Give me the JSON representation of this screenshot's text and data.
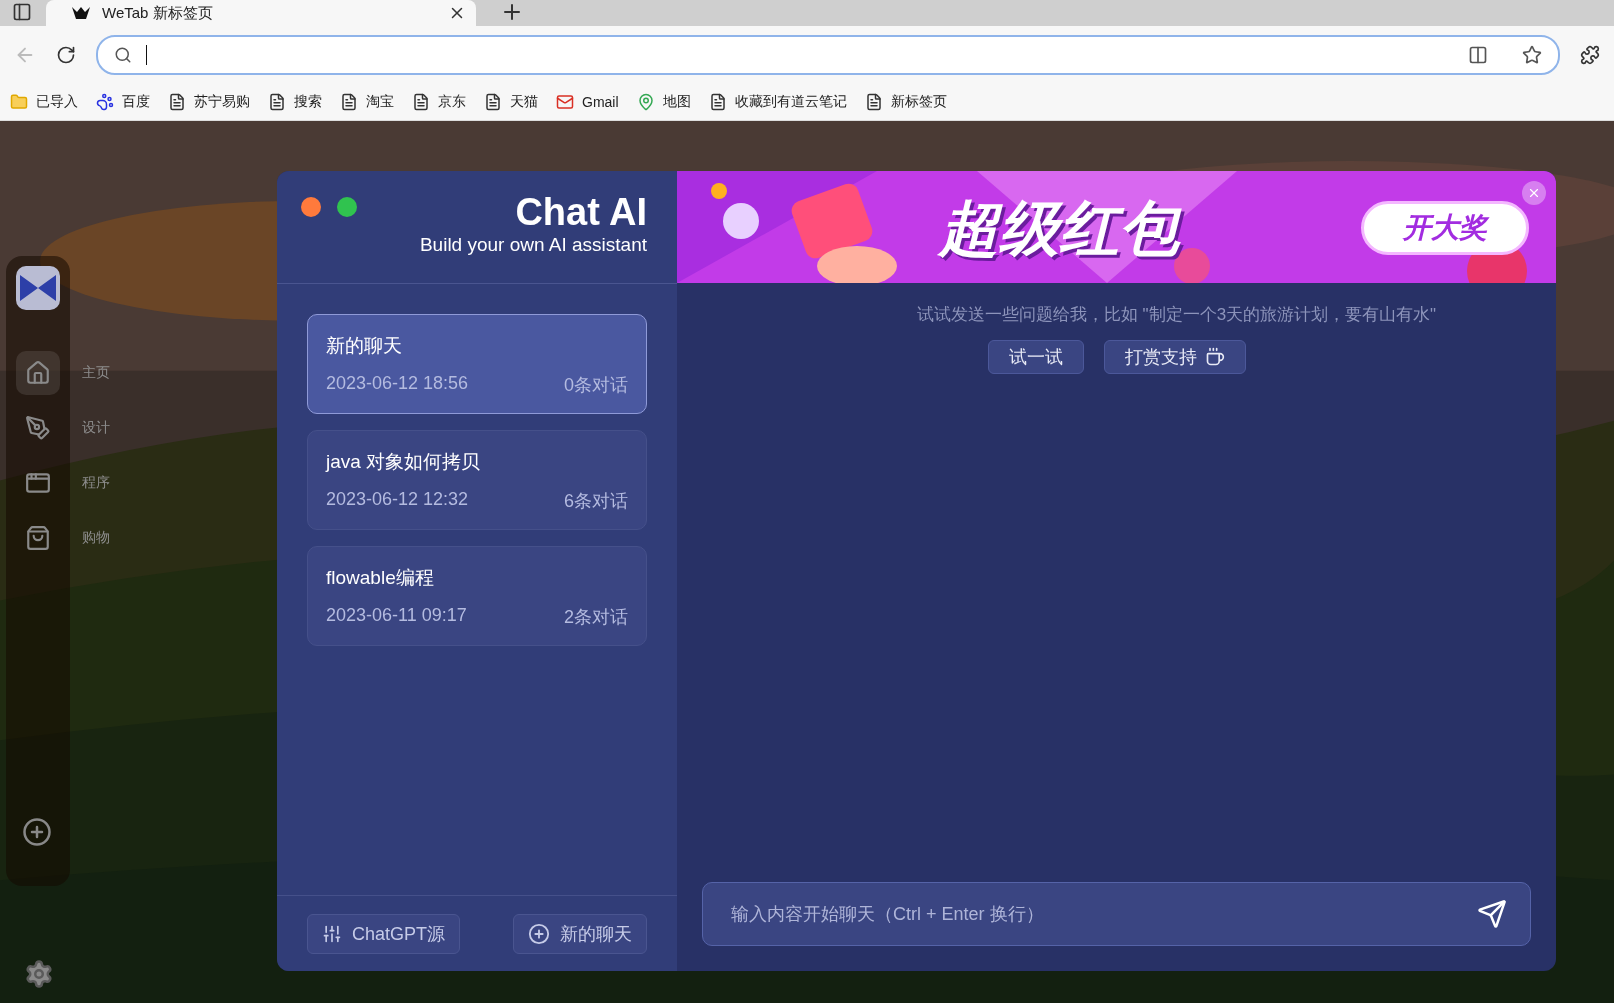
{
  "browser": {
    "tab": {
      "title": "WeTab 新标签页"
    },
    "bookmarks": [
      {
        "label": "已导入",
        "kind": "folder"
      },
      {
        "label": "百度",
        "kind": "baidu"
      },
      {
        "label": "苏宁易购",
        "kind": "page"
      },
      {
        "label": "搜索",
        "kind": "page"
      },
      {
        "label": "淘宝",
        "kind": "page"
      },
      {
        "label": "京东",
        "kind": "page"
      },
      {
        "label": "天猫",
        "kind": "page"
      },
      {
        "label": "Gmail",
        "kind": "gmail"
      },
      {
        "label": "地图",
        "kind": "maps"
      },
      {
        "label": "收藏到有道云笔记",
        "kind": "page"
      },
      {
        "label": "新标签页",
        "kind": "page"
      }
    ]
  },
  "dock": {
    "items": [
      {
        "label": "主页",
        "kind": "home",
        "selected": true
      },
      {
        "label": "设计",
        "kind": "design",
        "selected": false
      },
      {
        "label": "程序",
        "kind": "code",
        "selected": false
      },
      {
        "label": "购物",
        "kind": "shop",
        "selected": false
      }
    ]
  },
  "chat": {
    "title": "Chat AI",
    "subtitle": "Build your own AI assistant",
    "banner": {
      "headline": "超级红包",
      "cta": "开大奖"
    },
    "sessions": [
      {
        "title": "新的聊天",
        "time": "2023-06-12 18:56",
        "count": "0条对话",
        "selected": true
      },
      {
        "title": "java 对象如何拷贝",
        "time": "2023-06-12 12:32",
        "count": "6条对话",
        "selected": false
      },
      {
        "title": "flowable编程",
        "time": "2023-06-11 09:17",
        "count": "2条对话",
        "selected": false
      }
    ],
    "footer_buttons": [
      {
        "label": "ChatGPT源",
        "kind": "sliders"
      },
      {
        "label": "新的聊天",
        "kind": "add"
      }
    ],
    "hint": "试试发送一些问题给我，比如 \"制定一个3天的旅游计划，要有山有水\"",
    "actions": [
      {
        "label": "试一试",
        "kind": "plain"
      },
      {
        "label": "打赏支持",
        "kind": "coffee"
      }
    ],
    "input": {
      "placeholder": "输入内容开始聊天（Ctrl + Enter 换行）"
    }
  }
}
